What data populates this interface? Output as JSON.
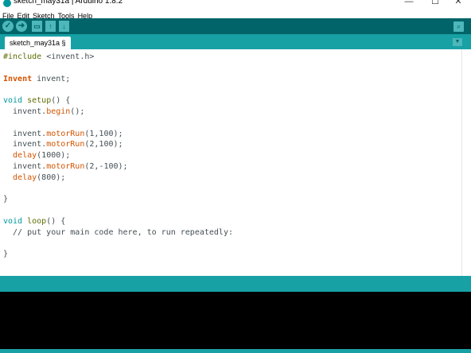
{
  "window": {
    "title": "sketch_may31a | Arduino 1.8.2",
    "controls": {
      "minimize": "—",
      "maximize": "☐",
      "close": "✕"
    }
  },
  "menu": {
    "items": [
      "File",
      "Edit",
      "Sketch",
      "Tools",
      "Help"
    ]
  },
  "toolbar": {
    "verify_glyph": "✓",
    "upload_glyph": "➜",
    "new_glyph": "▭",
    "open_glyph": "↑",
    "save_glyph": "↓",
    "serial_monitor_glyph": "⌕"
  },
  "tabs": [
    {
      "label": "sketch_may31a §"
    }
  ],
  "tab_menu_glyph": "▼",
  "colors": {
    "toolbar_bg": "#006468",
    "tab_bar_bg": "#17a1a5",
    "button_bg": "#4db7bb",
    "keyword_type": "#00979c",
    "keyword_class": "#d35400",
    "function": "#d35400",
    "comment": "#434f54",
    "directive": "#5e6d03",
    "console_bg": "#000000"
  },
  "code": {
    "lines": [
      [
        {
          "t": "#include ",
          "c": "#5e6d03"
        },
        {
          "t": "<invent.h>",
          "c": "#434f54"
        }
      ],
      [],
      [
        {
          "t": "Invent",
          "c": "#d35400",
          "b": true
        },
        {
          "t": " invent;",
          "c": "#434f54"
        }
      ],
      [],
      [
        {
          "t": "void",
          "c": "#00979c"
        },
        {
          "t": " ",
          "c": "#434f54"
        },
        {
          "t": "setup",
          "c": "#5e6d03"
        },
        {
          "t": "() {",
          "c": "#434f54"
        }
      ],
      [
        {
          "t": "  invent.",
          "c": "#434f54"
        },
        {
          "t": "begin",
          "c": "#d35400"
        },
        {
          "t": "();",
          "c": "#434f54"
        }
      ],
      [],
      [
        {
          "t": "  invent.",
          "c": "#434f54"
        },
        {
          "t": "motorRun",
          "c": "#d35400"
        },
        {
          "t": "(1,100);",
          "c": "#434f54"
        }
      ],
      [
        {
          "t": "  invent.",
          "c": "#434f54"
        },
        {
          "t": "motorRun",
          "c": "#d35400"
        },
        {
          "t": "(2,100);",
          "c": "#434f54"
        }
      ],
      [
        {
          "t": "  ",
          "c": "#434f54"
        },
        {
          "t": "delay",
          "c": "#d35400"
        },
        {
          "t": "(1000);",
          "c": "#434f54"
        }
      ],
      [
        {
          "t": "  invent.",
          "c": "#434f54"
        },
        {
          "t": "motorRun",
          "c": "#d35400"
        },
        {
          "t": "(2,-100);",
          "c": "#434f54"
        }
      ],
      [
        {
          "t": "  ",
          "c": "#434f54"
        },
        {
          "t": "delay",
          "c": "#d35400"
        },
        {
          "t": "(800);",
          "c": "#434f54"
        }
      ],
      [],
      [
        {
          "t": "}",
          "c": "#434f54"
        }
      ],
      [],
      [
        {
          "t": "void",
          "c": "#00979c"
        },
        {
          "t": " ",
          "c": "#434f54"
        },
        {
          "t": "loop",
          "c": "#5e6d03"
        },
        {
          "t": "() {",
          "c": "#434f54"
        }
      ],
      [
        {
          "t": "  // put your main code here, to run repeatedly:",
          "c": "#434f54"
        }
      ],
      [],
      [
        {
          "t": "}",
          "c": "#434f54"
        }
      ]
    ]
  }
}
